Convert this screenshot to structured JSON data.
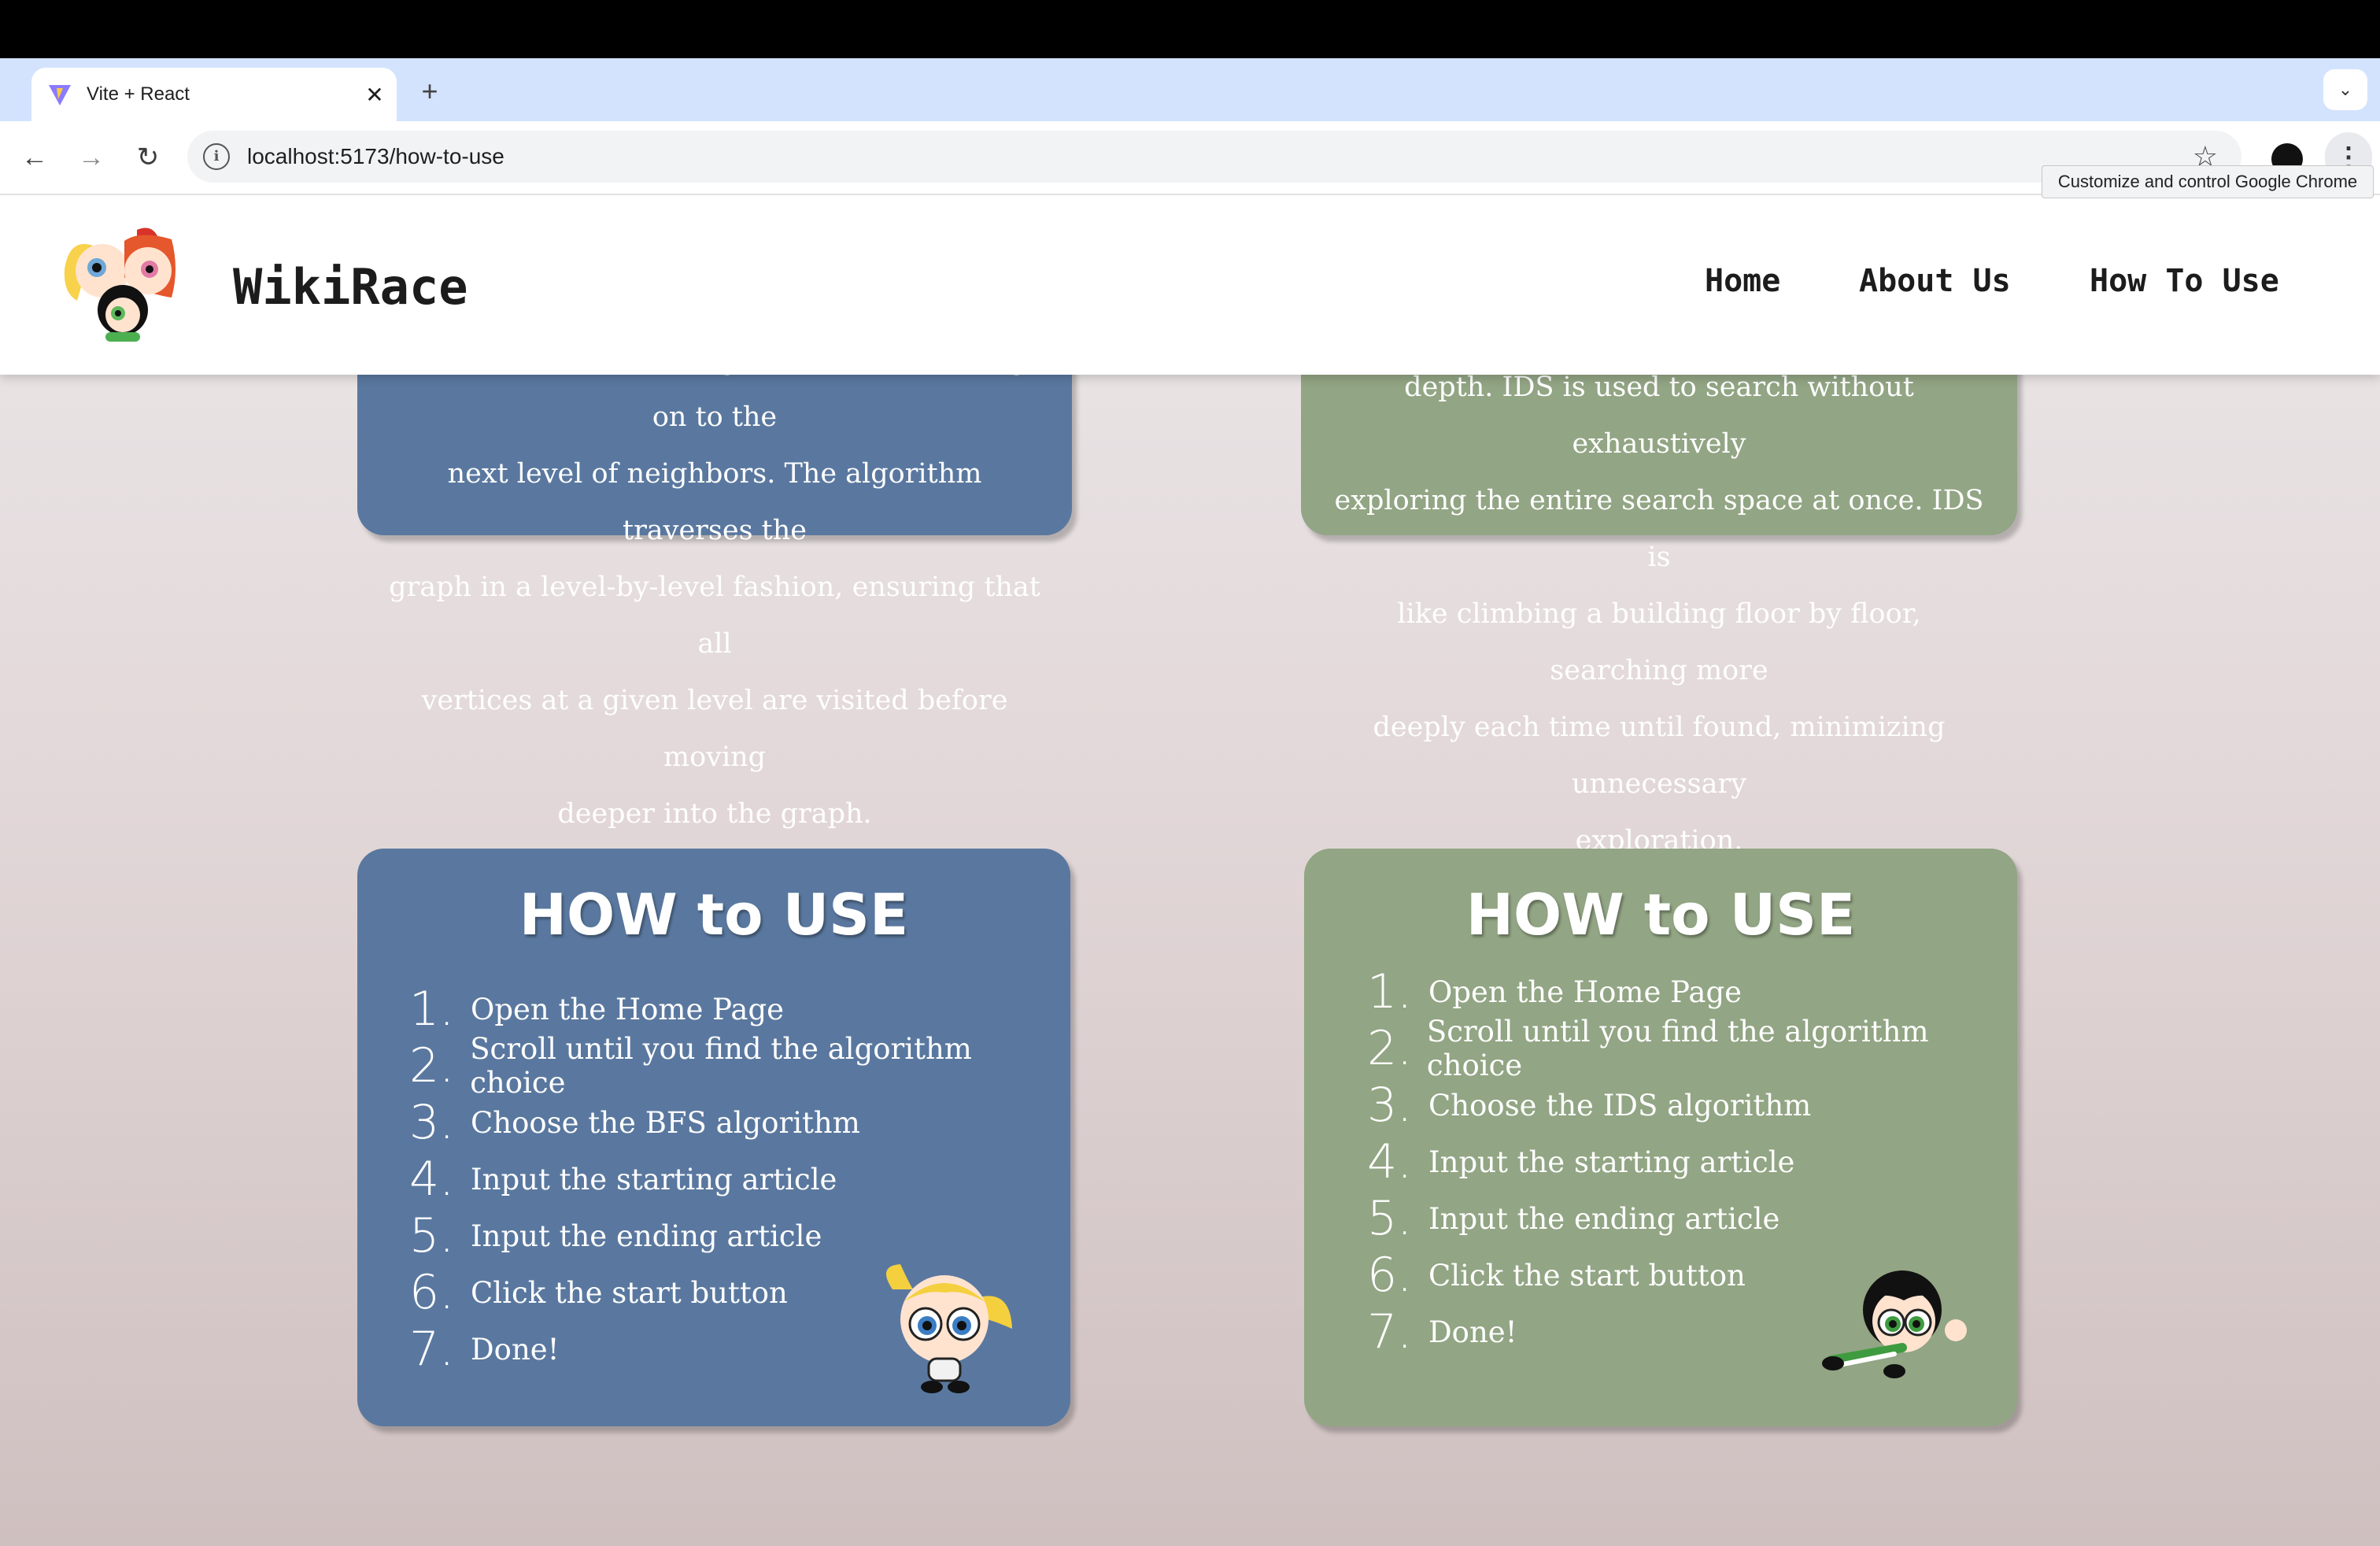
{
  "browser": {
    "tab_title": "Vite + React",
    "new_tab_symbol": "+",
    "url": "localhost:5173/how-to-use",
    "tooltip": "Customize and control Google Chrome",
    "icons": [
      "vite-favicon",
      "close-icon",
      "plus-icon",
      "chevron-down-icon",
      "back-arrow-icon",
      "forward-arrow-icon",
      "reload-icon",
      "info-icon",
      "star-icon",
      "profile-avatar",
      "kebab-menu-icon"
    ]
  },
  "site": {
    "brand": "WikiRace",
    "nav": [
      {
        "label": "Home"
      },
      {
        "label": "About Us"
      },
      {
        "label": "How To Use"
      }
    ]
  },
  "bfs_card": {
    "lines": [
      "and explores all its neighbors before moving on to the",
      "next level of neighbors. The algorithm traverses the",
      "graph in a level-by-level fashion, ensuring that all",
      "vertices at a given level are visited before moving",
      "deeper into the graph."
    ]
  },
  "ids_card": {
    "lines": [
      "depth. IDS is used to search without exhaustively",
      "exploring the entire search space at once. IDS is",
      "like climbing a building floor by floor, searching more",
      "deeply each time until found, minimizing unnecessary",
      "exploration."
    ]
  },
  "how_to_bfs": {
    "title": "HOW to USE",
    "steps": [
      {
        "num": "1.",
        "text": "Open the Home Page"
      },
      {
        "num": "2.",
        "text": "Scroll until you find the algorithm choice"
      },
      {
        "num": "3.",
        "text": "Choose the BFS algorithm"
      },
      {
        "num": "4.",
        "text": "Input the starting article"
      },
      {
        "num": "5.",
        "text": "Input the ending article"
      },
      {
        "num": "6.",
        "text": "Click the start button"
      },
      {
        "num": "7.",
        "text": "Done!"
      }
    ]
  },
  "how_to_ids": {
    "title": "HOW to USE",
    "steps": [
      {
        "num": "1.",
        "text": "Open the Home Page"
      },
      {
        "num": "2.",
        "text": "Scroll until you find the algorithm choice"
      },
      {
        "num": "3.",
        "text": "Choose the IDS algorithm"
      },
      {
        "num": "4.",
        "text": "Input the starting article"
      },
      {
        "num": "5.",
        "text": "Input the ending article"
      },
      {
        "num": "6.",
        "text": "Click the start button"
      },
      {
        "num": "7.",
        "text": "Done!"
      }
    ]
  },
  "colors": {
    "bfs_card": "#5a789f",
    "ids_card": "#92a584",
    "tab_strip": "#d3e3fd"
  }
}
